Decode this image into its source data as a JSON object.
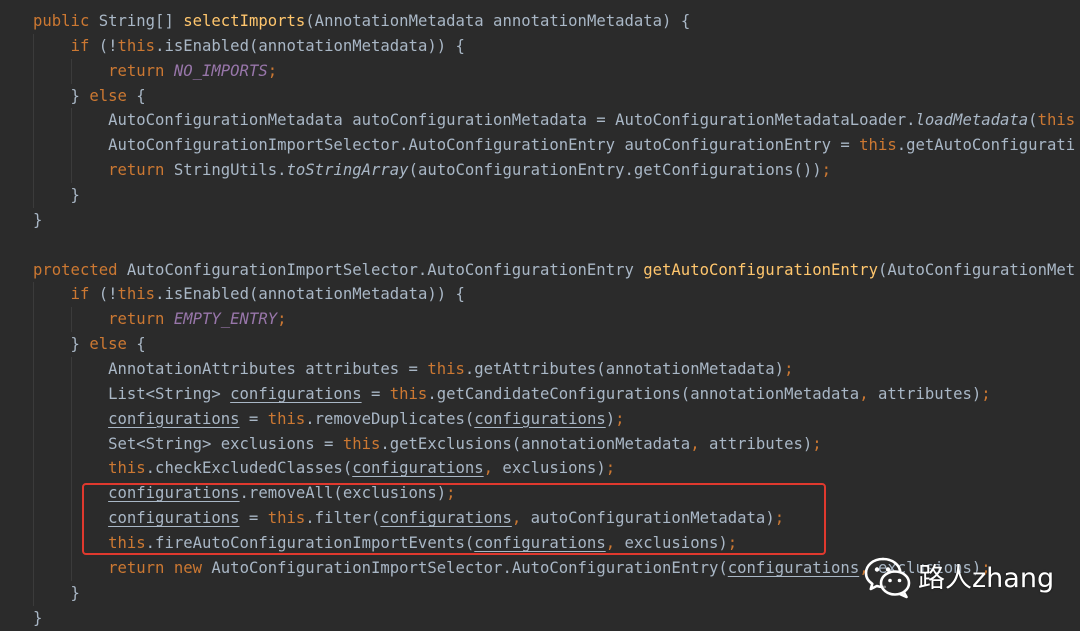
{
  "editor": {
    "colors": {
      "background": "#2b2b2b",
      "text": "#a9b7c6",
      "keyword": "#cc7832",
      "method_declaration": "#ffc66d",
      "constant": "#9876aa",
      "indent_guide": "#3b3b3b",
      "highlight_box": "#e0392e"
    },
    "lines": [
      {
        "tokens": [
          {
            "t": "public",
            "c": "#cc7832"
          },
          {
            "t": " String[] "
          },
          {
            "t": "selectImports",
            "c": "#ffc66d"
          },
          {
            "t": "(AnnotationMetadata annotationMetadata) {"
          }
        ]
      },
      {
        "tokens": [
          {
            "t": "    "
          },
          {
            "t": "if",
            "c": "#cc7832"
          },
          {
            "t": " (!"
          },
          {
            "t": "this",
            "c": "#cc7832"
          },
          {
            "t": ".isEnabled(annotationMetadata)) {"
          }
        ]
      },
      {
        "tokens": [
          {
            "t": "        "
          },
          {
            "t": "return",
            "c": "#cc7832"
          },
          {
            "t": " "
          },
          {
            "t": "NO_IMPORTS",
            "c": "#9876aa",
            "i": true
          },
          {
            "t": ";",
            "c": "#cc7832"
          }
        ]
      },
      {
        "tokens": [
          {
            "t": "    } "
          },
          {
            "t": "else",
            "c": "#cc7832"
          },
          {
            "t": " {"
          }
        ]
      },
      {
        "tokens": [
          {
            "t": "        AutoConfigurationMetadata autoConfigurationMetadata = AutoConfigurationMetadataLoader."
          },
          {
            "t": "loadMetadata",
            "i": true
          },
          {
            "t": "("
          },
          {
            "t": "this",
            "c": "#cc7832"
          }
        ]
      },
      {
        "tokens": [
          {
            "t": "        AutoConfigurationImportSelector.AutoConfigurationEntry autoConfigurationEntry = "
          },
          {
            "t": "this",
            "c": "#cc7832"
          },
          {
            "t": ".getAutoConfigurati"
          }
        ]
      },
      {
        "tokens": [
          {
            "t": "        "
          },
          {
            "t": "return",
            "c": "#cc7832"
          },
          {
            "t": " StringUtils."
          },
          {
            "t": "toStringArray",
            "i": true
          },
          {
            "t": "(autoConfigurationEntry.getConfigurations())"
          },
          {
            "t": ";",
            "c": "#cc7832"
          }
        ]
      },
      {
        "tokens": [
          {
            "t": "    }"
          }
        ]
      },
      {
        "tokens": [
          {
            "t": "}"
          }
        ]
      },
      {
        "tokens": []
      },
      {
        "tokens": [
          {
            "t": "protected",
            "c": "#cc7832"
          },
          {
            "t": " AutoConfigurationImportSelector.AutoConfigurationEntry "
          },
          {
            "t": "getAutoConfigurationEntry",
            "c": "#ffc66d"
          },
          {
            "t": "(AutoConfigurationMet"
          }
        ]
      },
      {
        "tokens": [
          {
            "t": "    "
          },
          {
            "t": "if",
            "c": "#cc7832"
          },
          {
            "t": " (!"
          },
          {
            "t": "this",
            "c": "#cc7832"
          },
          {
            "t": ".isEnabled(annotationMetadata)) {"
          }
        ]
      },
      {
        "tokens": [
          {
            "t": "        "
          },
          {
            "t": "return",
            "c": "#cc7832"
          },
          {
            "t": " "
          },
          {
            "t": "EMPTY_ENTRY",
            "c": "#9876aa",
            "i": true
          },
          {
            "t": ";",
            "c": "#cc7832"
          }
        ]
      },
      {
        "tokens": [
          {
            "t": "    } "
          },
          {
            "t": "else",
            "c": "#cc7832"
          },
          {
            "t": " {"
          }
        ]
      },
      {
        "tokens": [
          {
            "t": "        AnnotationAttributes attributes = "
          },
          {
            "t": "this",
            "c": "#cc7832"
          },
          {
            "t": ".getAttributes(annotationMetadata)"
          },
          {
            "t": ";",
            "c": "#cc7832"
          }
        ]
      },
      {
        "tokens": [
          {
            "t": "        List<String> "
          },
          {
            "t": "configurations",
            "u": true
          },
          {
            "t": " = "
          },
          {
            "t": "this",
            "c": "#cc7832"
          },
          {
            "t": ".getCandidateConfigurations(annotationMetadata"
          },
          {
            "t": ",",
            "c": "#cc7832"
          },
          {
            "t": " attributes)"
          },
          {
            "t": ";",
            "c": "#cc7832"
          }
        ]
      },
      {
        "tokens": [
          {
            "t": "        "
          },
          {
            "t": "configurations",
            "u": true
          },
          {
            "t": " = "
          },
          {
            "t": "this",
            "c": "#cc7832"
          },
          {
            "t": ".removeDuplicates("
          },
          {
            "t": "configurations",
            "u": true
          },
          {
            "t": ")"
          },
          {
            "t": ";",
            "c": "#cc7832"
          }
        ]
      },
      {
        "tokens": [
          {
            "t": "        Set<String> exclusions = "
          },
          {
            "t": "this",
            "c": "#cc7832"
          },
          {
            "t": ".getExclusions(annotationMetadata"
          },
          {
            "t": ",",
            "c": "#cc7832"
          },
          {
            "t": " attributes)"
          },
          {
            "t": ";",
            "c": "#cc7832"
          }
        ]
      },
      {
        "tokens": [
          {
            "t": "        "
          },
          {
            "t": "this",
            "c": "#cc7832"
          },
          {
            "t": ".checkExcludedClasses("
          },
          {
            "t": "configurations",
            "u": true
          },
          {
            "t": ",",
            "c": "#cc7832"
          },
          {
            "t": " exclusions)"
          },
          {
            "t": ";",
            "c": "#cc7832"
          }
        ]
      },
      {
        "tokens": [
          {
            "t": "        "
          },
          {
            "t": "configurations",
            "u": true
          },
          {
            "t": ".removeAll(exclusions)"
          },
          {
            "t": ";",
            "c": "#cc7832"
          }
        ]
      },
      {
        "tokens": [
          {
            "t": "        "
          },
          {
            "t": "configurations",
            "u": true
          },
          {
            "t": " = "
          },
          {
            "t": "this",
            "c": "#cc7832"
          },
          {
            "t": ".filter("
          },
          {
            "t": "configurations",
            "u": true
          },
          {
            "t": ",",
            "c": "#cc7832"
          },
          {
            "t": " autoConfigurationMetadata)"
          },
          {
            "t": ";",
            "c": "#cc7832"
          }
        ]
      },
      {
        "tokens": [
          {
            "t": "        "
          },
          {
            "t": "this",
            "c": "#cc7832"
          },
          {
            "t": ".fireAutoConfigurationImportEvents("
          },
          {
            "t": "configurations",
            "u": true
          },
          {
            "t": ",",
            "c": "#cc7832"
          },
          {
            "t": " exclusions)"
          },
          {
            "t": ";",
            "c": "#cc7832"
          }
        ]
      },
      {
        "tokens": [
          {
            "t": "        "
          },
          {
            "t": "return",
            "c": "#cc7832"
          },
          {
            "t": " "
          },
          {
            "t": "new",
            "c": "#cc7832"
          },
          {
            "t": " AutoConfigurationImportSelector.AutoConfigurationEntry("
          },
          {
            "t": "configurations",
            "u": true
          },
          {
            "t": ",",
            "c": "#cc7832"
          },
          {
            "t": " exclusions)"
          },
          {
            "t": ";",
            "c": "#cc7832"
          }
        ]
      },
      {
        "tokens": [
          {
            "t": "    }"
          }
        ]
      },
      {
        "tokens": [
          {
            "t": "}"
          }
        ]
      }
    ]
  },
  "watermark": {
    "icon": "wechat-icon",
    "text": "路人zhang",
    "color": "#ffffff"
  }
}
